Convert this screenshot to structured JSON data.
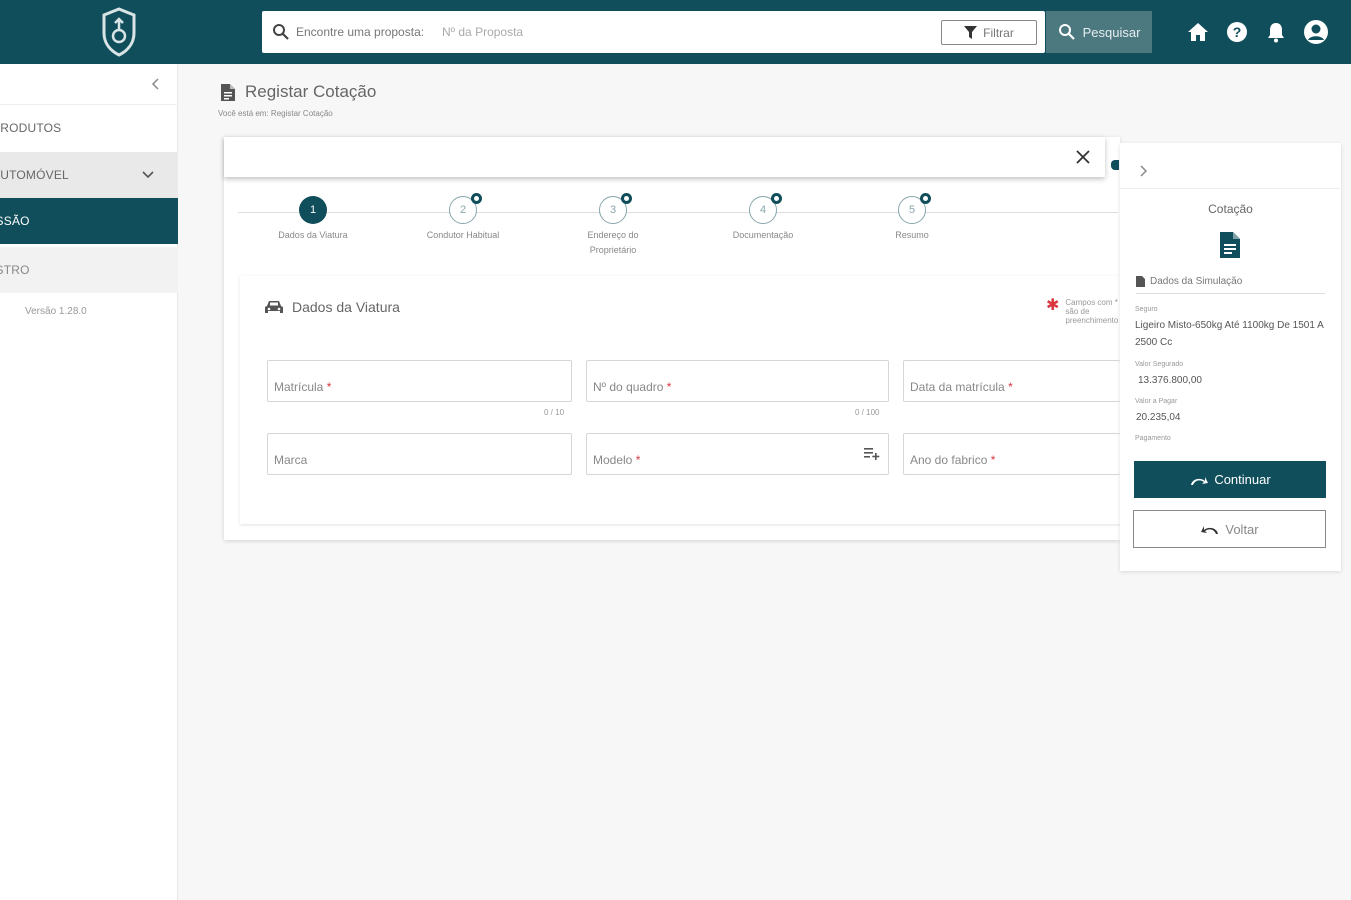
{
  "header": {
    "search_label": "Encontre uma proposta:",
    "search_placeholder": "Nº da Proposta",
    "filter_label": "Filtrar",
    "search_button": "Pesquisar"
  },
  "sidebar": {
    "items": [
      {
        "label": "PRODUTOS"
      },
      {
        "label": "AUTOMÓVEL"
      },
      {
        "label": "ISSÃO"
      },
      {
        "label": "ISTRO"
      }
    ],
    "version": "Versão 1.28.0"
  },
  "page": {
    "title": "Registar Cotação",
    "breadcrumb": "Você está em:  Registar Cotação"
  },
  "stepper": [
    {
      "num": "1",
      "label": "Dados da Viatura"
    },
    {
      "num": "2",
      "label": "Condutor Habitual"
    },
    {
      "num": "3",
      "label": "Endereço do Proprietário"
    },
    {
      "num": "4",
      "label": "Documentação"
    },
    {
      "num": "5",
      "label": "Resumo"
    }
  ],
  "section": {
    "title": "Dados da Viatura",
    "required_note": "Campos com * são de preenchimento",
    "fields": {
      "matricula": "Matrícula",
      "matricula_counter": "0 / 10",
      "quadro": "Nº do quadro",
      "quadro_counter": "0 / 100",
      "data_matricula": "Data da matrícula",
      "marca": "Marca",
      "modelo": "Modelo",
      "ano_fabrico": "Ano do fabrico"
    },
    "required_mark": "*"
  },
  "panel": {
    "title": "Cotação",
    "sim_title": "Dados da Simulação",
    "seguro_label": "Seguro",
    "seguro_value": "Ligeiro Misto-650kg Até 1100kg De 1501 A 2500 Cc",
    "valor_segurado_label": "Valor Segurado",
    "valor_segurado_value": "13.376.800,00",
    "valor_pagar_label": "Valor a Pagar",
    "valor_pagar_value": "20.235,04",
    "pagamento_label": "Pagamento",
    "continue_label": "Continuar",
    "back_label": "Voltar"
  },
  "colors": {
    "primary": "#0f4e5a",
    "search_button": "#4c7880",
    "required": "#d9363e"
  }
}
